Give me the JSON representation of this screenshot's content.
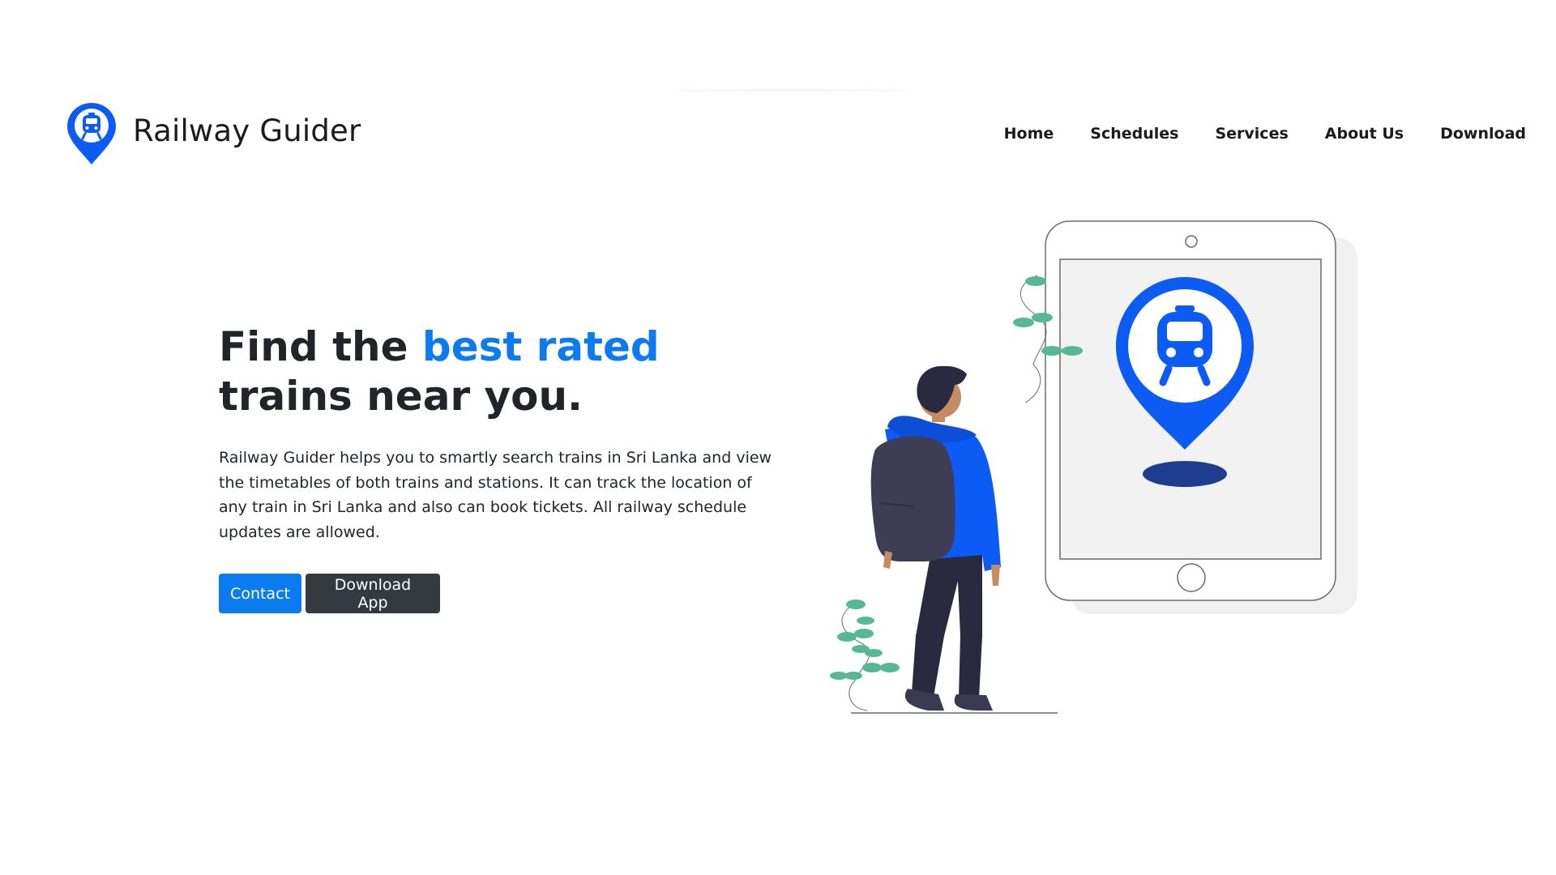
{
  "brand": {
    "name": "Railway Guider",
    "logo_icon": "location-pin-train-icon",
    "color": "#0d5bf5"
  },
  "nav": {
    "items": [
      "Home",
      "Schedules",
      "Services",
      "About Us",
      "Download"
    ]
  },
  "hero": {
    "title_part1": "Find the ",
    "title_accent": "best rated",
    "title_part2": "trains near you.",
    "description": "Railway Guider helps you to smartly search trains in Sri Lanka and view the timetables of both trains and stations. It can track the location of any train in Sri Lanka and also can book tickets. All railway schedule updates are allowed.",
    "accent_color": "#0d7bf0"
  },
  "buttons": {
    "contact_label": "Contact",
    "download_label": "Download App"
  },
  "illustration": {
    "icon": "person-with-tablet-map-pin-illustration",
    "pin_color": "#0d5bf5",
    "leaf_color": "#57b894"
  }
}
